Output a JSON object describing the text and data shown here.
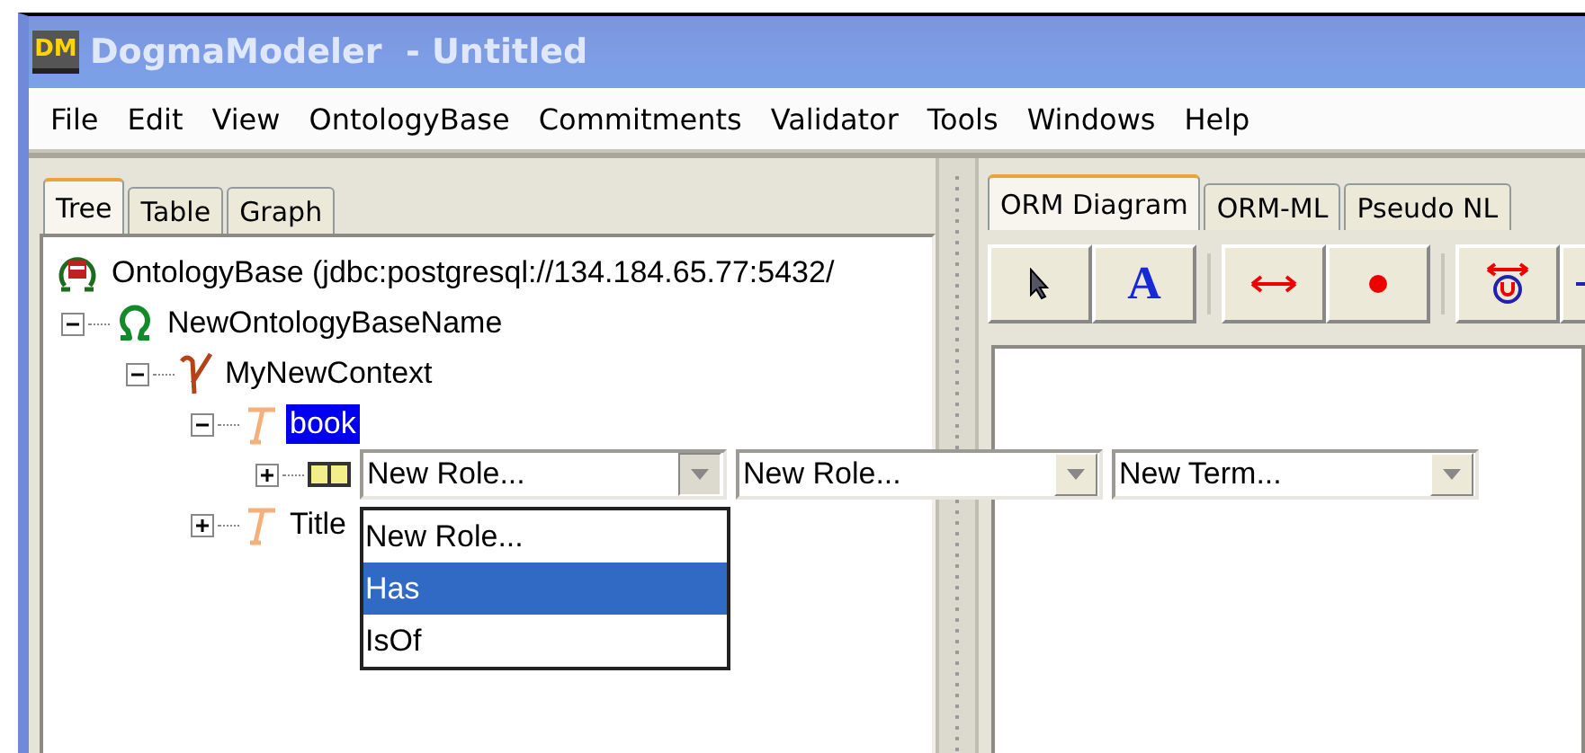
{
  "window": {
    "icon_text": "DM",
    "title": "DogmaModeler  - Untitled"
  },
  "menu": [
    "File",
    "Edit",
    "View",
    "OntologyBase",
    "Commitments",
    "Validator",
    "Tools",
    "Windows",
    "Help"
  ],
  "left_tabs": [
    {
      "label": "Tree",
      "selected": true
    },
    {
      "label": "Table",
      "selected": false
    },
    {
      "label": "Graph",
      "selected": false
    }
  ],
  "tree": [
    {
      "kind": "database",
      "label": "OntologyBase (jdbc:postgresql://134.184.65.77:5432/",
      "selected": false,
      "children": [
        {
          "kind": "ontology",
          "label": "NewOntologyBaseName",
          "expanded": true,
          "selected": false,
          "children": [
            {
              "kind": "context",
              "label": "MyNewContext",
              "expanded": true,
              "selected": false,
              "children": [
                {
                  "kind": "term",
                  "label": "book",
                  "expanded": true,
                  "selected": true,
                  "children": [
                    {
                      "kind": "lexon",
                      "expanded": false,
                      "editor": {
                        "combos": [
                          {
                            "value": "New Role...",
                            "open": true
                          },
                          {
                            "value": "New Role...",
                            "open": false
                          },
                          {
                            "value": "New Term...",
                            "open": false
                          }
                        ],
                        "options": [
                          {
                            "label": "New Role...",
                            "selected": false
                          },
                          {
                            "label": "Has",
                            "selected": true
                          },
                          {
                            "label": "IsOf",
                            "selected": false
                          }
                        ]
                      }
                    }
                  ]
                },
                {
                  "kind": "term",
                  "label": "Title",
                  "expanded": false,
                  "selected": false
                }
              ]
            }
          ]
        }
      ]
    }
  ],
  "right_tabs": [
    {
      "label": "ORM Diagram",
      "selected": true
    },
    {
      "label": "ORM-ML",
      "selected": false
    },
    {
      "label": "Pseudo NL",
      "selected": false
    }
  ],
  "toolbar": [
    {
      "tools": [
        {
          "kind": "pointer"
        },
        {
          "kind": "text",
          "label": "A"
        }
      ]
    },
    {
      "tools": [
        {
          "kind": "role"
        },
        {
          "kind": "dot"
        }
      ]
    },
    {
      "tools": [
        {
          "kind": "uniqueness"
        },
        {
          "kind": "cut"
        }
      ]
    }
  ]
}
